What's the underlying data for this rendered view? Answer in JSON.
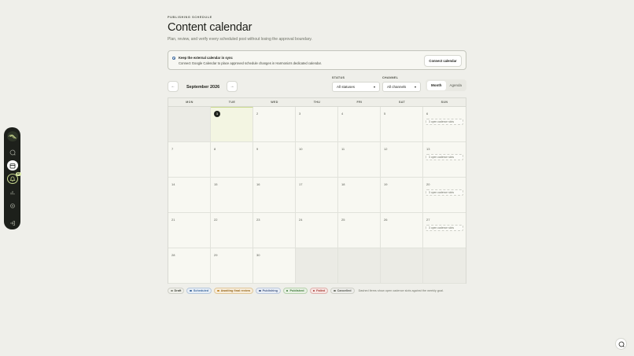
{
  "header": {
    "eyebrow": "PUBLISHING SCHEDULE",
    "title": "Content calendar",
    "subtitle": "Plan, review, and verify every scheduled post without losing the approval boundary."
  },
  "sync": {
    "title": "Keep the external calendar in sync",
    "description": "Connect Google Calendar to place approved schedule changes in Harmonia's dedicated calendar.",
    "button": "Connect calendar"
  },
  "toolbar": {
    "prev": "←",
    "next": "→",
    "month": "September 2026",
    "status_label": "STATUS",
    "status_value": "All statuses",
    "channel_label": "CHANNEL",
    "channel_value": "All channels",
    "view_month": "Month",
    "view_agenda": "Agenda"
  },
  "calendar": {
    "weekdays": [
      "MON",
      "TUE",
      "WED",
      "THU",
      "FRI",
      "SAT",
      "SUN"
    ],
    "weeks": [
      [
        "",
        "1",
        "2",
        "3",
        "4",
        "5",
        "6"
      ],
      [
        "7",
        "8",
        "9",
        "10",
        "11",
        "12",
        "13"
      ],
      [
        "14",
        "15",
        "16",
        "17",
        "18",
        "19",
        "20"
      ],
      [
        "21",
        "22",
        "23",
        "24",
        "25",
        "26",
        "27"
      ],
      [
        "28",
        "29",
        "30",
        "",
        "",
        "",
        ""
      ]
    ],
    "slot_text": "3 open cadence slots"
  },
  "sidebar": {
    "badge": "12"
  },
  "legend": {
    "draft": "Draft",
    "scheduled": "Scheduled",
    "awaiting": "Awaiting final review",
    "publishing": "Publishing",
    "published": "Published",
    "failed": "Failed",
    "cancelled": "Cancelled",
    "note": "Dashed items show open cadence slots against the weekly goal."
  },
  "colors": {
    "sidebar_bg": "#1d201b",
    "accent_lime": "#c9d98f",
    "background": "#efefea"
  }
}
